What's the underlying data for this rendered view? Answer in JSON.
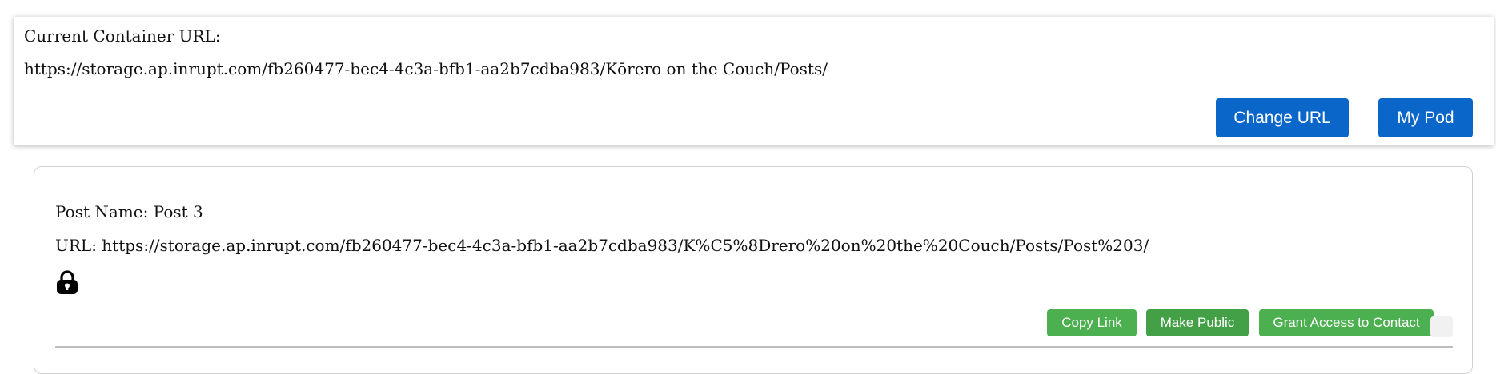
{
  "container": {
    "label": "Current Container URL:",
    "url": "https://storage.ap.inrupt.com/fb260477-bec4-4c3a-bfb1-aa2b7cdba983/Kōrero on the Couch/Posts/",
    "change_url_label": "Change URL",
    "my_pod_label": "My Pod"
  },
  "post": {
    "name_text": "Post Name: Post 3",
    "url_text": "URL: https://storage.ap.inrupt.com/fb260477-bec4-4c3a-bfb1-aa2b7cdba983/K%C5%8Drero%20on%20the%20Couch/Posts/Post%203/",
    "lock_icon": "lock-icon",
    "copy_link_label": "Copy Link",
    "make_public_label": "Make Public",
    "grant_access_label": "Grant Access to Contact"
  },
  "colors": {
    "primary_blue": "#0a66c8",
    "action_green": "#4caf50"
  }
}
